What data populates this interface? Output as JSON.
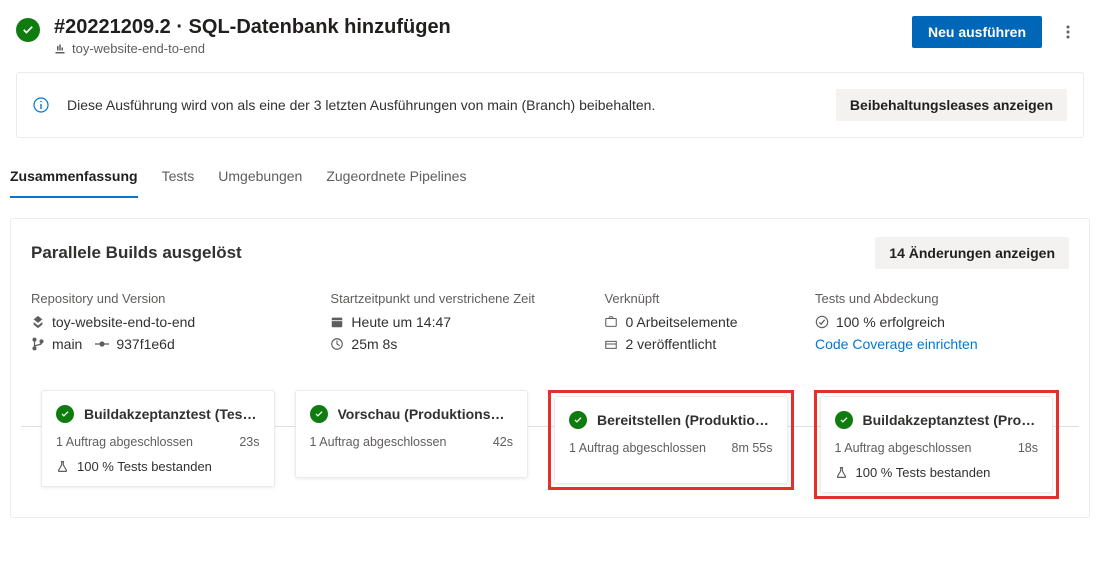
{
  "header": {
    "title": "#20221209.2 · SQL-Datenbank hinzufügen",
    "pipeline": "toy-website-end-to-end",
    "rerunLabel": "Neu ausführen"
  },
  "banner": {
    "message": "Diese Ausführung wird von als eine der 3 letzten Ausführungen von main (Branch) beibehalten.",
    "actionLabel": "Beibehaltungsleases anzeigen"
  },
  "tabs": {
    "summary": "Zusammenfassung",
    "tests": "Tests",
    "environments": "Umgebungen",
    "pipelines": "Zugeordnete Pipelines"
  },
  "card": {
    "title": "Parallele Builds ausgelöst",
    "changesLabel": "14 Änderungen anzeigen"
  },
  "meta": {
    "repoLabel": "Repository und Version",
    "repo": "toy-website-end-to-end",
    "branch": "main",
    "commit": "937f1e6d",
    "timeLabel": "Startzeitpunkt und verstrichene Zeit",
    "started": "Heute um 14:47",
    "elapsed": "25m 8s",
    "relatedLabel": "Verknüpft",
    "workItems": "0 Arbeitselemente",
    "published": "2 veröffentlicht",
    "testsLabel": "Tests und Abdeckung",
    "testsResult": "100 % erfolgreich",
    "coverageLink": "Code Coverage einrichten"
  },
  "stages": [
    {
      "title": "Buildakzeptanztest (Test…",
      "sub": "1 Auftrag abgeschlossen",
      "dur": "23s",
      "tests": "100 % Tests bestanden",
      "highlight": false
    },
    {
      "title": "Vorschau (Produktions…",
      "sub": "1 Auftrag abgeschlossen",
      "dur": "42s",
      "tests": "",
      "highlight": false
    },
    {
      "title": "Bereitstellen (Produktion…",
      "sub": "1 Auftrag abgeschlossen",
      "dur": "8m 55s",
      "tests": "",
      "highlight": true
    },
    {
      "title": "Buildakzeptanztest (Prod…",
      "sub": "1 Auftrag abgeschlossen",
      "dur": "18s",
      "tests": "100 % Tests bestanden",
      "highlight": true
    }
  ]
}
